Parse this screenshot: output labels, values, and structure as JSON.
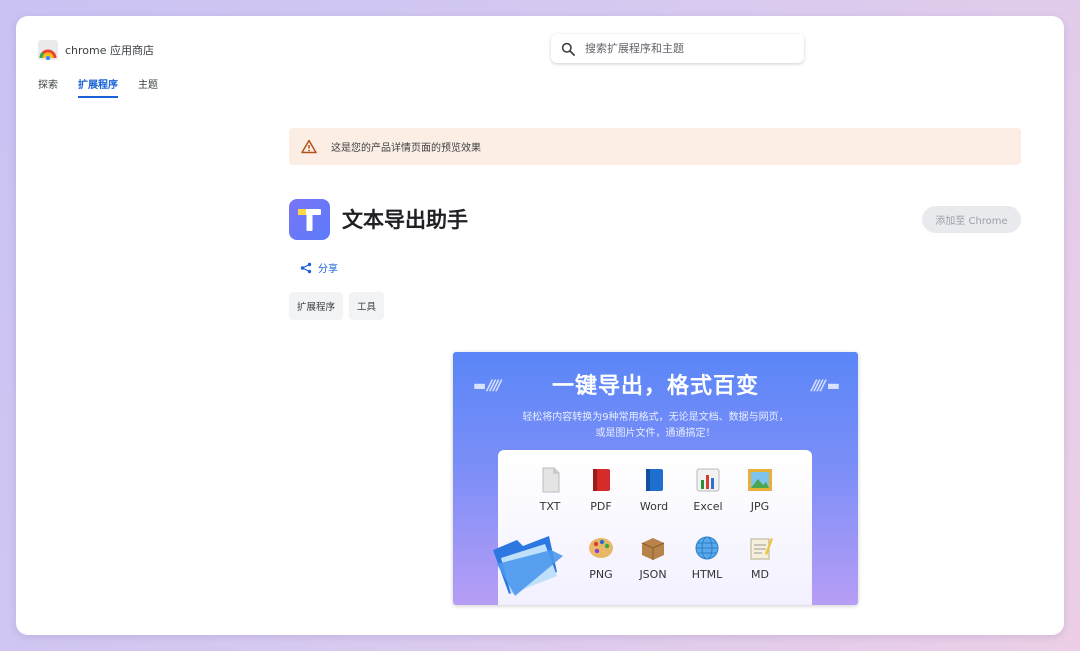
{
  "header": {
    "store_title": "chrome 应用商店"
  },
  "nav": {
    "items": [
      {
        "label": "探索"
      },
      {
        "label": "扩展程序"
      },
      {
        "label": "主题"
      }
    ]
  },
  "search": {
    "placeholder": "搜索扩展程序和主题"
  },
  "banner": {
    "text": "这是您的产品详情页面的预览效果"
  },
  "app": {
    "title": "文本导出助手",
    "add_button": "添加至 Chrome",
    "share_label": "分享",
    "tags": [
      "扩展程序",
      "工具"
    ]
  },
  "promo": {
    "headline": "一键导出，格式百变",
    "subline_1": "轻松将内容转换为9种常用格式，无论是文档、数据与网页，",
    "subline_2": "或是图片文件，通通搞定！",
    "formats": [
      {
        "label": "TXT",
        "icon": "txt-file-icon"
      },
      {
        "label": "PDF",
        "icon": "pdf-book-icon"
      },
      {
        "label": "Word",
        "icon": "word-book-icon"
      },
      {
        "label": "Excel",
        "icon": "excel-chart-icon"
      },
      {
        "label": "JPG",
        "icon": "jpg-picture-icon"
      },
      {
        "label": "PNG",
        "icon": "png-palette-icon"
      },
      {
        "label": "JSON",
        "icon": "json-box-icon"
      },
      {
        "label": "HTML",
        "icon": "html-globe-icon"
      },
      {
        "label": "MD",
        "icon": "md-notepad-icon"
      }
    ]
  },
  "colors": {
    "accent": "#1a63d6",
    "banner_bg": "#fdeee5",
    "app_icon": "#6b78f8"
  }
}
